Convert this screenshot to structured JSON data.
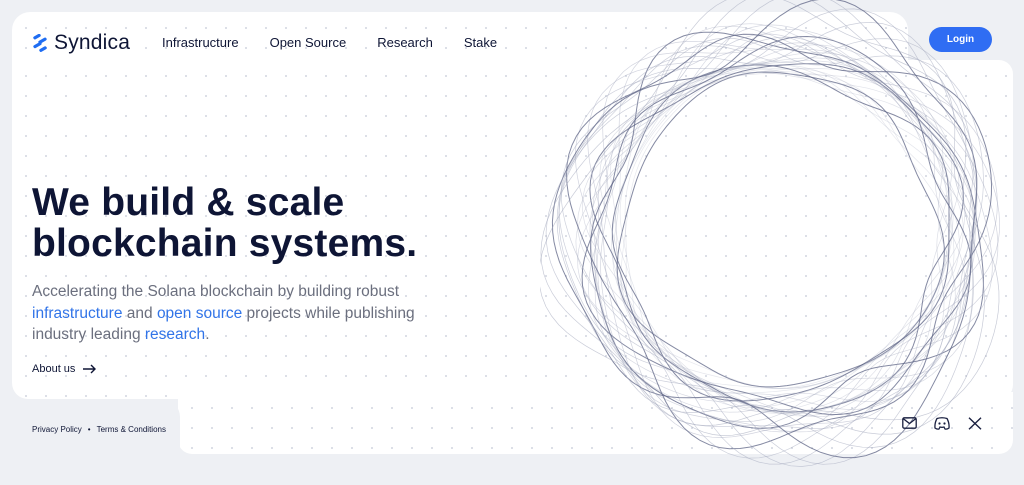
{
  "brand": {
    "name": "Syndica",
    "accent": "#2f6df3"
  },
  "nav": {
    "items": [
      "Infrastructure",
      "Open Source",
      "Research",
      "Stake"
    ]
  },
  "header": {
    "login_label": "Login"
  },
  "hero": {
    "title_line1": "We build & scale",
    "title_line2": "blockchain systems.",
    "lead_part1": "Accelerating the Solana blockchain by building robust ",
    "lead_link1": "infrastructure",
    "lead_part2": " and ",
    "lead_link2": "open source",
    "lead_part3": " projects while publishing industry leading ",
    "lead_link3": "research",
    "lead_part4": ".",
    "cta_label": "About us"
  },
  "footer": {
    "privacy_label": "Privacy Policy",
    "separator": "•",
    "terms_label": "Terms & Conditions",
    "social_icons": [
      "mail-icon",
      "discord-icon",
      "x-icon"
    ]
  }
}
